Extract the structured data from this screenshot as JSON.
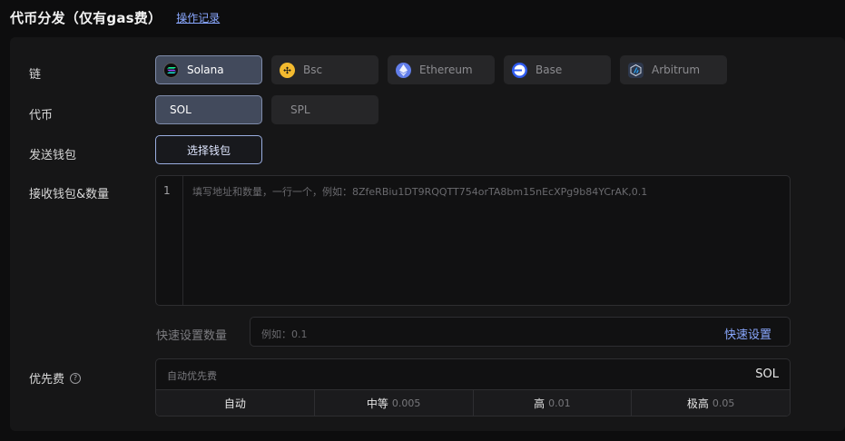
{
  "header": {
    "title": "代币分发（仅有gas费）",
    "op_link": "操作记录"
  },
  "form": {
    "chain_label": "链",
    "token_label": "代币",
    "wallet_label": "发送钱包",
    "receive_label": "接收钱包&数量",
    "fee_label": "优先费"
  },
  "chains": [
    {
      "label": "Solana",
      "icon": "solana-icon",
      "color": "#0d0d0d",
      "active": true
    },
    {
      "label": "Bsc",
      "icon": "bnb-icon",
      "color": "#f3ba2f",
      "active": false
    },
    {
      "label": "Ethereum",
      "icon": "ethereum-icon",
      "color": "#627eea",
      "active": false
    },
    {
      "label": "Base",
      "icon": "base-icon",
      "color": "#2f5bf0",
      "active": false
    },
    {
      "label": "Arbitrum",
      "icon": "arbitrum-icon",
      "color": "#2d374b",
      "active": false
    }
  ],
  "tokens": [
    {
      "label": "SOL",
      "active": true
    },
    {
      "label": "SPL",
      "active": false
    }
  ],
  "wallet_button": "选择钱包",
  "editor": {
    "line_number": "1",
    "placeholder": "填写地址和数量，一行一个，例如：8ZfeRBiu1DT9RQQTT754orTA8bm15nEcXPg9b84YCrAK,0.1"
  },
  "quick": {
    "label": "快速设置数量",
    "placeholder": "例如：0.1",
    "button": "快速设置"
  },
  "fee": {
    "placeholder": "自动优先费",
    "unit": "SOL",
    "options": [
      {
        "label": "自动",
        "value": ""
      },
      {
        "label": "中等",
        "value": "0.005"
      },
      {
        "label": "高",
        "value": "0.01"
      },
      {
        "label": "极高",
        "value": "0.05"
      }
    ]
  },
  "colors": {
    "accent": "#8aa8ff",
    "active_bg": "#424a5c",
    "panel": "#161617"
  }
}
